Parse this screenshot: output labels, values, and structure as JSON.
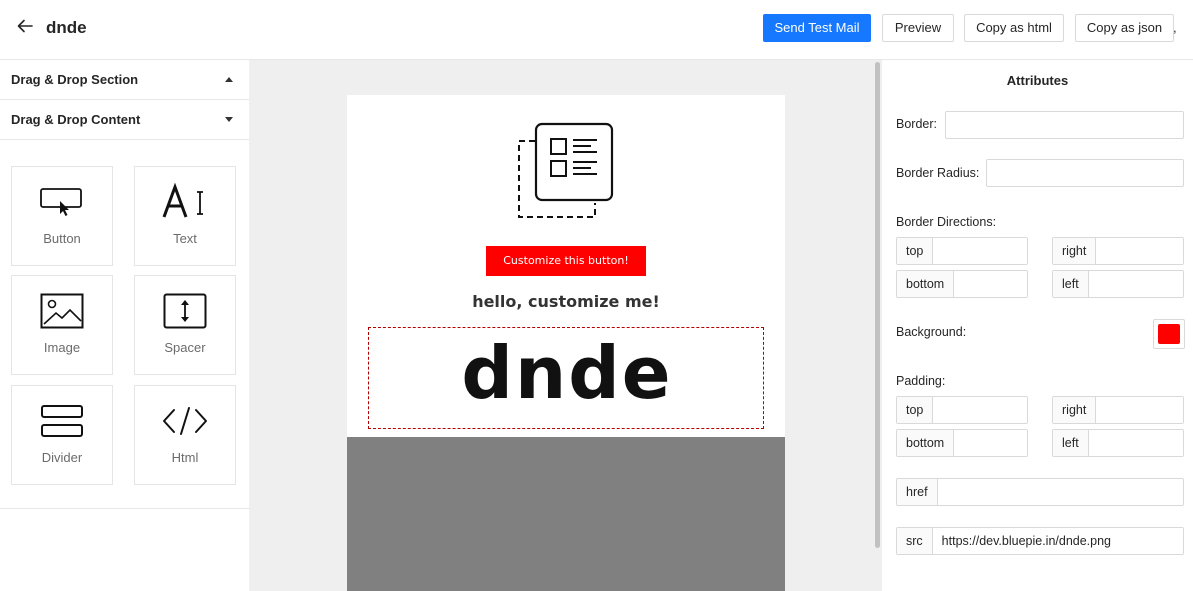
{
  "header": {
    "title": "dnde",
    "buttons": {
      "send_test_mail": "Send Test Mail",
      "preview": "Preview",
      "copy_html": "Copy as html",
      "copy_json": "Copy as json"
    },
    "trailing_text": ","
  },
  "sidebar": {
    "section_header": "Drag & Drop Section",
    "content_header": "Drag & Drop Content",
    "tiles": [
      {
        "label": "Button",
        "icon": "button-icon"
      },
      {
        "label": "Text",
        "icon": "text-icon"
      },
      {
        "label": "Image",
        "icon": "image-icon"
      },
      {
        "label": "Spacer",
        "icon": "spacer-icon"
      },
      {
        "label": "Divider",
        "icon": "divider-icon"
      },
      {
        "label": "Html",
        "icon": "html-icon"
      }
    ]
  },
  "canvas": {
    "button_text": "Customize this button!",
    "heading": "hello, customize me!",
    "logo_text": "dnde"
  },
  "attributes": {
    "title": "Attributes",
    "border_label": "Border",
    "border_value": "",
    "border_radius_label": "Border Radius",
    "border_radius_value": "",
    "border_directions_label": "Border Directions",
    "directions": {
      "top": "top",
      "right": "right",
      "bottom": "bottom",
      "left": "left"
    },
    "background_label": "Background",
    "background_color": "#ff0000",
    "padding_label": "Padding",
    "href_label": "href",
    "href_value": "",
    "src_label": "src",
    "src_value": "https://dev.bluepie.in/dnde.png",
    "colon": ":"
  },
  "colors": {
    "primary": "#1677ff",
    "email_button": "#ff0000",
    "canvas_bg": "#efefef",
    "email_footer": "#808080"
  }
}
